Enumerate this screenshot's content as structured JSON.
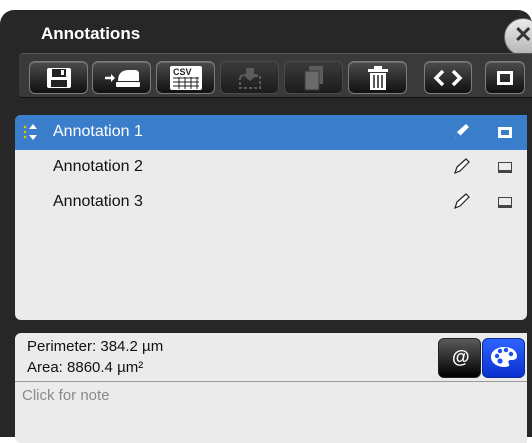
{
  "window": {
    "title": "Annotations"
  },
  "toolbar": {
    "buttons": [
      {
        "name": "save-button",
        "icon": "floppy-disk-icon",
        "enabled": true
      },
      {
        "name": "import-button",
        "icon": "import-icon",
        "enabled": true
      },
      {
        "name": "export-csv-button",
        "icon": "csv-icon",
        "enabled": true,
        "label": "CSV"
      },
      {
        "name": "move-button",
        "icon": "move-icon",
        "enabled": false
      },
      {
        "name": "copy-button",
        "icon": "copy-icon",
        "enabled": false
      },
      {
        "name": "delete-button",
        "icon": "trash-icon",
        "enabled": true
      },
      {
        "name": "prev-next-button",
        "icon": "chevron-left-right-icon",
        "enabled": true
      },
      {
        "name": "toggle-all-visibility-button",
        "icon": "square-icon",
        "enabled": true
      }
    ]
  },
  "annotations": [
    {
      "label": "Annotation 1",
      "selected": true
    },
    {
      "label": "Annotation 2",
      "selected": false
    },
    {
      "label": "Annotation 3",
      "selected": false
    }
  ],
  "measurements": {
    "perimeter": "Perimeter: 384.2 µm",
    "area": "Area: 8860.4 µm²"
  },
  "note": {
    "placeholder": "Click for note"
  },
  "info_buttons": {
    "at_label": "@"
  },
  "colors": {
    "selection": "#3a7dcb",
    "palette_button": "#1b4ff0",
    "panel": "#272727"
  }
}
